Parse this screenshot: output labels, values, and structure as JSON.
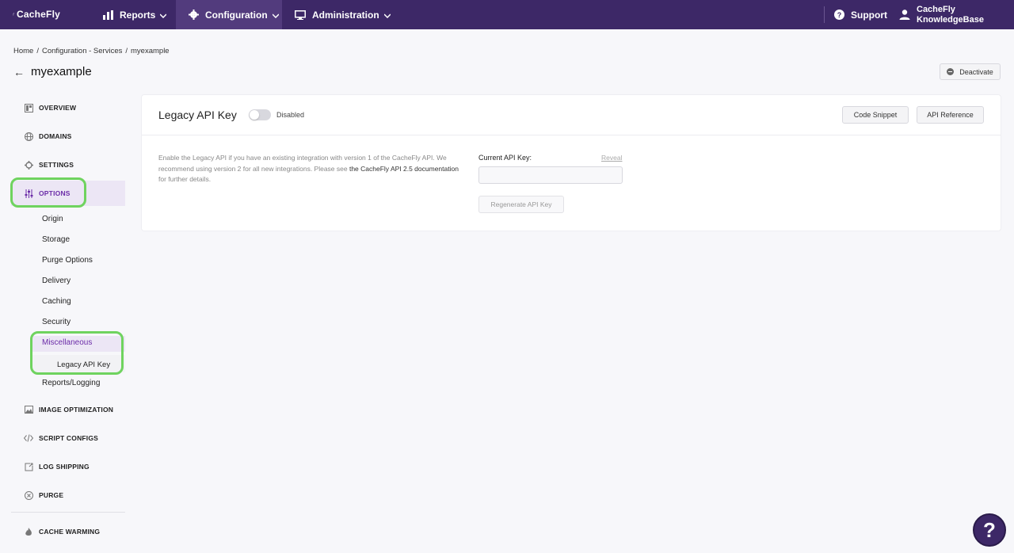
{
  "topbar": {
    "logo_text": "CacheFly",
    "nav": {
      "reports": "Reports",
      "configuration": "Configuration",
      "administration": "Administration"
    },
    "support": "Support",
    "user_line1": "CacheFly",
    "user_line2": "KnowledgeBase",
    "colors": {
      "bg": "#3d2867",
      "active": "#523b7d"
    }
  },
  "breadcrumb": [
    "Home",
    "/",
    "Configuration - Services",
    "/",
    "myexample"
  ],
  "page": {
    "title": "myexample",
    "back_icon": "arrow-left-icon",
    "deactivate_label": "Deactivate"
  },
  "sidebar": {
    "main": [
      {
        "label": "OVERVIEW",
        "icon": "overview-icon"
      },
      {
        "label": "DOMAINS",
        "icon": "globe-icon"
      },
      {
        "label": "SETTINGS",
        "icon": "gear-icon"
      },
      {
        "label": "OPTIONS",
        "icon": "sliders-icon",
        "active": true
      }
    ],
    "options_sub": [
      "Origin",
      "Storage",
      "Purge Options",
      "Delivery",
      "Caching",
      "Security",
      "Miscellaneous",
      "Legacy API Key",
      "Reports/Logging"
    ],
    "main2": [
      {
        "label": "IMAGE OPTIMIZATION",
        "icon": "image-icon"
      },
      {
        "label": "SCRIPT CONFIGS",
        "icon": "code-icon"
      },
      {
        "label": "LOG SHIPPING",
        "icon": "export-icon"
      },
      {
        "label": "PURGE",
        "icon": "purge-icon"
      },
      {
        "label": "CACHE WARMING",
        "icon": "flame-icon"
      }
    ],
    "accent": "#6b2ca8"
  },
  "card": {
    "title": "Legacy API Key",
    "toggle_state": "Disabled",
    "code_snippet": "Code Snippet",
    "api_reference": "API Reference",
    "desc_before": "Enable the Legacy API if you have an existing integration with version 1 of the CacheFly API. We recommend using version 2 for all new integrations. Please see ",
    "desc_link": "the CacheFly API 2.5 documentation",
    "desc_after": " for further details.",
    "current_key_label": "Current API Key:",
    "reveal": "Reveal",
    "key_value": "",
    "regenerate": "Regenerate API Key"
  },
  "help_label": "?"
}
